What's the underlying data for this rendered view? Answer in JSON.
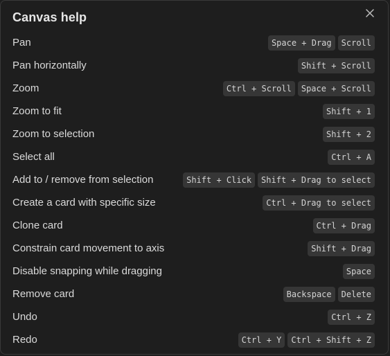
{
  "dialog": {
    "title": "Canvas help",
    "close_icon": "close-icon"
  },
  "shortcuts": [
    {
      "label": "Pan",
      "keys": [
        "Space + Drag",
        "Scroll"
      ]
    },
    {
      "label": "Pan horizontally",
      "keys": [
        "Shift + Scroll"
      ]
    },
    {
      "label": "Zoom",
      "keys": [
        "Ctrl + Scroll",
        "Space + Scroll"
      ]
    },
    {
      "label": "Zoom to fit",
      "keys": [
        "Shift + 1"
      ]
    },
    {
      "label": "Zoom to selection",
      "keys": [
        "Shift + 2"
      ]
    },
    {
      "label": "Select all",
      "keys": [
        "Ctrl + A"
      ]
    },
    {
      "label": "Add to / remove from selection",
      "keys": [
        "Shift + Click",
        "Shift + Drag to select"
      ]
    },
    {
      "label": "Create a card with specific size",
      "keys": [
        "Ctrl + Drag to select"
      ]
    },
    {
      "label": "Clone card",
      "keys": [
        "Ctrl + Drag"
      ]
    },
    {
      "label": "Constrain card movement to axis",
      "keys": [
        "Shift + Drag"
      ]
    },
    {
      "label": "Disable snapping while dragging",
      "keys": [
        "Space"
      ]
    },
    {
      "label": "Remove card",
      "keys": [
        "Backspace",
        "Delete"
      ]
    },
    {
      "label": "Undo",
      "keys": [
        "Ctrl + Z"
      ]
    },
    {
      "label": "Redo",
      "keys": [
        "Ctrl + Y",
        "Ctrl + Shift + Z"
      ]
    }
  ]
}
